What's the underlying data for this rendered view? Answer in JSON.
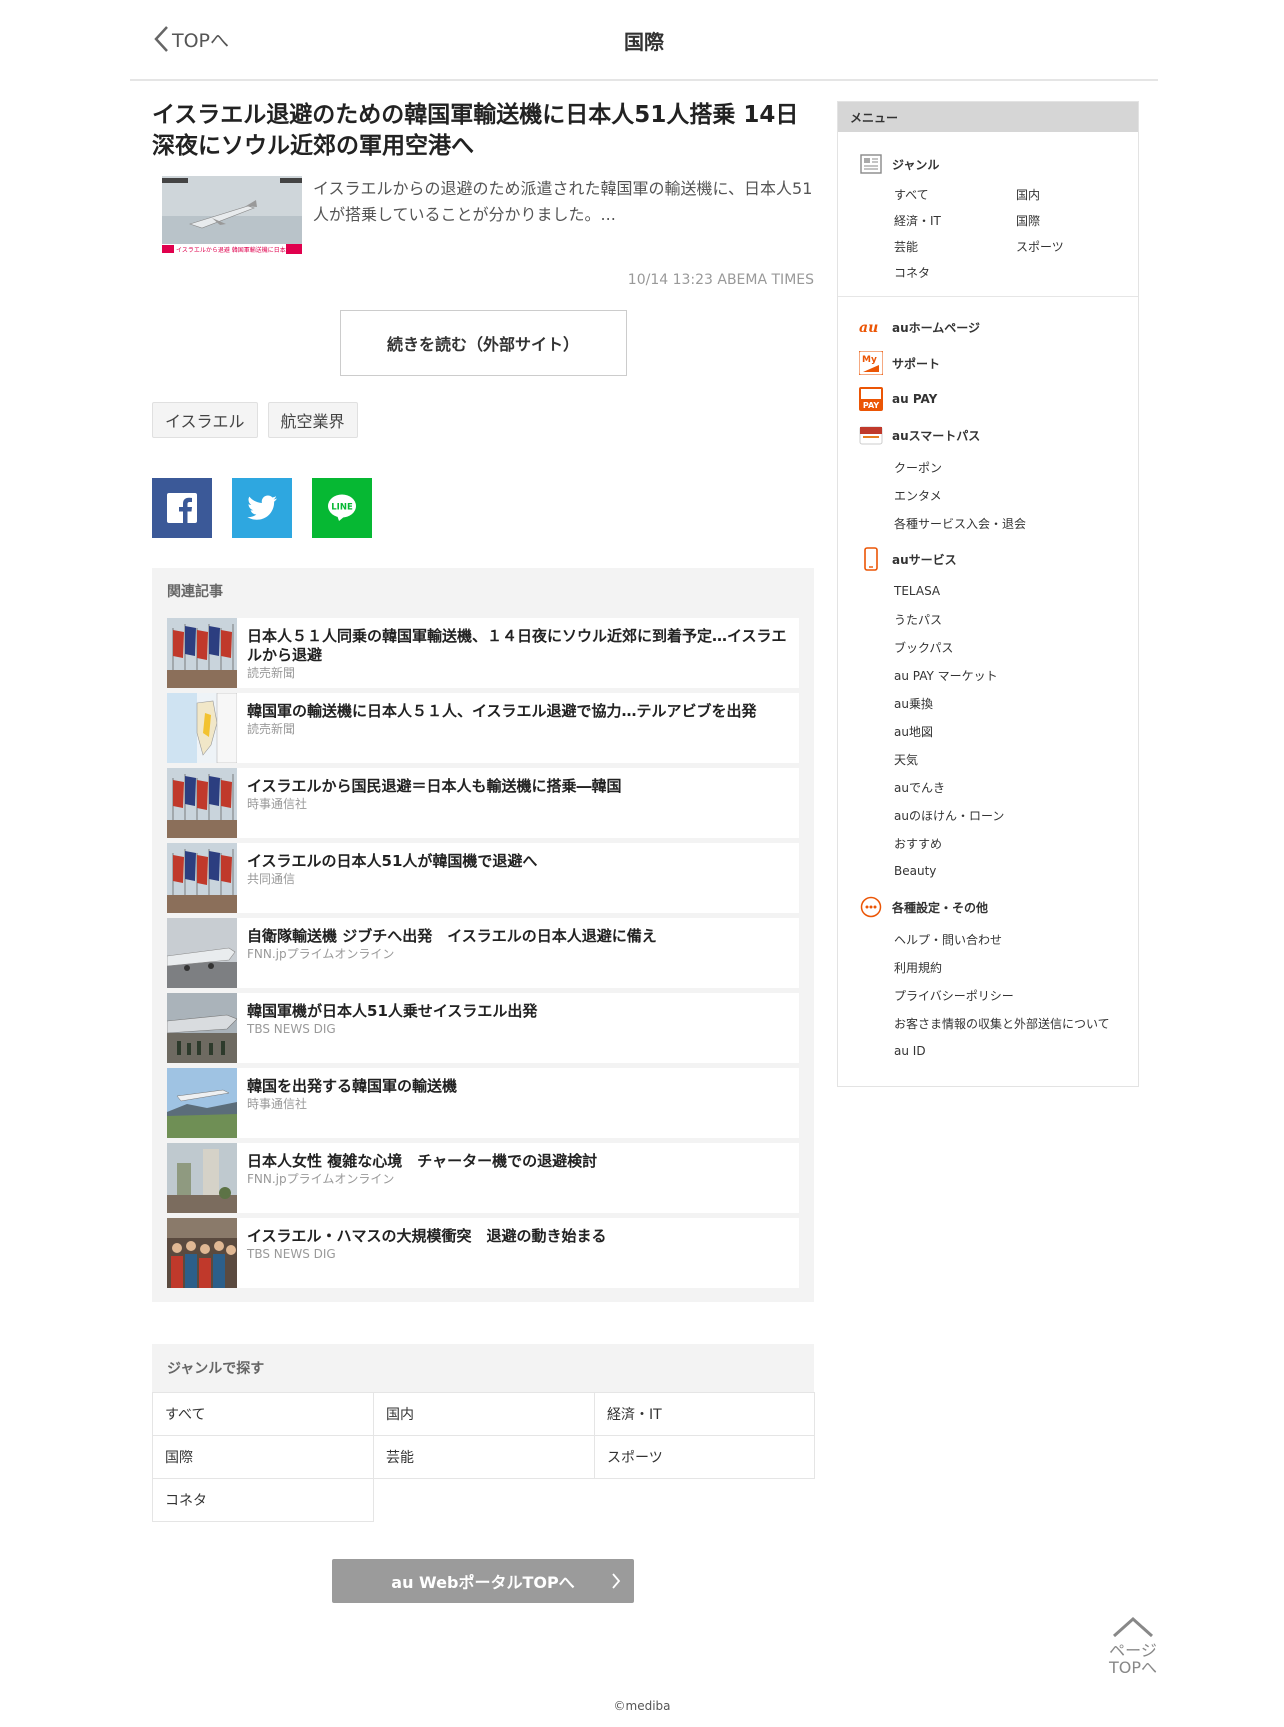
{
  "header": {
    "back_label": "TOPへ",
    "title": "国際"
  },
  "article": {
    "title": "イスラエル退避のための韓国軍輸送機に日本人51人搭乗 14日深夜にソウル近郊の軍用空港へ",
    "summary": "イスラエルからの退避のため派遣された韓国軍の輸送機に、日本人51人が搭乗していることが分かりました。...",
    "meta": "10/14 13:23  ABEMA TIMES",
    "read_more_label": "続きを読む（外部サイト）",
    "thumb_caption": "イスラエルから退避 韓国軍輸送機に日本人51人搭乗"
  },
  "tags": [
    "イスラエル",
    "航空業界"
  ],
  "share": {
    "line_label": "LINE"
  },
  "related": {
    "label": "関連記事",
    "items": [
      {
        "title": "日本人５１人同乗の韓国軍輸送機、１４日夜にソウル近郊に到着予定…イスラエルから退避",
        "source": "読売新聞",
        "thumb": "flags"
      },
      {
        "title": "韓国軍の輸送機に日本人５１人、イスラエル退避で協力…テルアビブを出発",
        "source": "読売新聞",
        "thumb": "map"
      },
      {
        "title": "イスラエルから国民退避＝日本人も輸送機に搭乗―韓国",
        "source": "時事通信社",
        "thumb": "flags"
      },
      {
        "title": "イスラエルの日本人51人が韓国機で退避へ",
        "source": "共同通信",
        "thumb": "flags"
      },
      {
        "title": "自衛隊輸送機 ジブチへ出発　イスラエルの日本人退避に備え",
        "source": "FNN.jpプライムオンライン",
        "thumb": "plane"
      },
      {
        "title": "韓国軍機が日本人51人乗せイスラエル出発",
        "source": "TBS NEWS DIG",
        "thumb": "plane2"
      },
      {
        "title": "韓国を出発する韓国軍の輸送機",
        "source": "時事通信社",
        "thumb": "sky"
      },
      {
        "title": "日本人女性 複雑な心境　チャーター機での退避検討",
        "source": "FNN.jpプライムオンライン",
        "thumb": "city"
      },
      {
        "title": "イスラエル・ハマスの大規模衝突　退避の動き始まる",
        "source": "TBS NEWS DIG",
        "thumb": "crowd"
      }
    ]
  },
  "genre_search": {
    "label": "ジャンルで探す",
    "items": [
      "すべて",
      "国内",
      "経済・IT",
      "国際",
      "芸能",
      "スポーツ",
      "コネタ"
    ]
  },
  "portal_button_label": "au WebポータルTOPへ",
  "sidebar": {
    "header": "メニュー",
    "genre_title": "ジャンル",
    "genres": [
      "すべて",
      "国内",
      "経済・IT",
      "国際",
      "芸能",
      "スポーツ",
      "コネタ"
    ],
    "au_home": "auホームページ",
    "support": "サポート",
    "au_pay": "au PAY",
    "smartpass": "auスマートパス",
    "smartpass_items": [
      "クーポン",
      "エンタメ",
      "各種サービス入会・退会"
    ],
    "services": "auサービス",
    "service_items": [
      "TELASA",
      "うたパス",
      "ブックパス",
      "au PAY マーケット",
      "au乗換",
      "au地図",
      "天気",
      "auでんき",
      "auのほけん・ローン",
      "おすすめ",
      "Beauty"
    ],
    "settings": "各種設定・その他",
    "settings_items": [
      "ヘルプ・問い合わせ",
      "利用規約",
      "プライバシーポリシー",
      "お客さま情報の収集と外部送信について",
      "au ID"
    ],
    "icon_labels": {
      "au_logo": "au",
      "my_au": "My",
      "pay": "PAY"
    }
  },
  "page_top": {
    "line1": "ページ",
    "line2": "TOPへ"
  },
  "footer": "©mediba",
  "colors": {
    "facebook": "#3b5998",
    "twitter": "#2ea7e0",
    "line": "#06b833",
    "au_orange": "#eb5505"
  }
}
